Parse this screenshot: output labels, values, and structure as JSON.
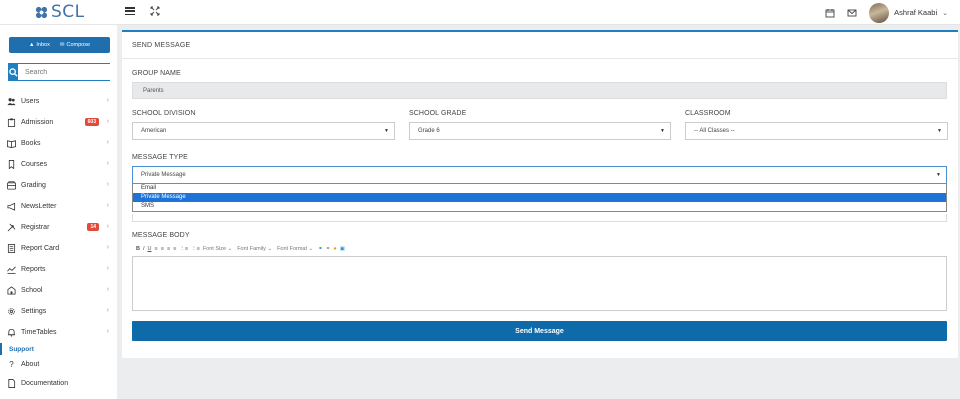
{
  "header": {
    "logo_text": "SCL",
    "user_name": "Ashraf Kaabi",
    "icons": [
      "menu-icon",
      "fullscreen-icon",
      "calendar-icon",
      "mail-icon",
      "chevron-down-icon"
    ]
  },
  "sidebar": {
    "inbox_label": "Inbox",
    "compose_label": "Compose",
    "search_placeholder": "Search",
    "items": [
      {
        "label": "Users",
        "icon": "users-icon"
      },
      {
        "label": "Admission",
        "icon": "clipboard-icon",
        "badge": "603"
      },
      {
        "label": "Books",
        "icon": "book-icon"
      },
      {
        "label": "Courses",
        "icon": "bookmark-icon"
      },
      {
        "label": "Grading",
        "icon": "grading-icon"
      },
      {
        "label": "NewsLetter",
        "icon": "megaphone-icon"
      },
      {
        "label": "Registrar",
        "icon": "arrows-icon",
        "badge": "14"
      },
      {
        "label": "Report Card",
        "icon": "report-card-icon"
      },
      {
        "label": "Reports",
        "icon": "line-chart-icon"
      },
      {
        "label": "School",
        "icon": "school-icon"
      },
      {
        "label": "Settings",
        "icon": "gear-icon"
      },
      {
        "label": "TimeTables",
        "icon": "bell-icon"
      }
    ],
    "support_label": "Support",
    "support_items": [
      {
        "label": "About",
        "icon": "question-icon"
      },
      {
        "label": "Documentation",
        "icon": "document-icon"
      }
    ]
  },
  "form": {
    "title": "SEND MESSAGE",
    "group_name_label": "GROUP NAME",
    "group_name_value": "Parents",
    "division_label": "SCHOOL DIVISION",
    "division_value": "American",
    "grade_label": "SCHOOL GRADE",
    "grade_value": "Grade 6",
    "classroom_label": "CLASSROOM",
    "classroom_value": "-- All Classes --",
    "message_type_label": "MESSAGE TYPE",
    "message_type_value": "Private Message",
    "message_type_options": [
      "Email",
      "Private Message",
      "SMS"
    ],
    "message_body_label": "MESSAGE BODY",
    "toolbar": {
      "bold": "B",
      "italic": "I",
      "underline": "U",
      "font_size": "Font Size",
      "font_family": "Font Family",
      "font_format": "Font Format"
    },
    "send_label": "Send Message"
  },
  "colors": {
    "primary": "#0f6aa9",
    "accent": "#1f7fbf",
    "badge": "#e04b3a",
    "selected_option": "#1e73d8"
  }
}
